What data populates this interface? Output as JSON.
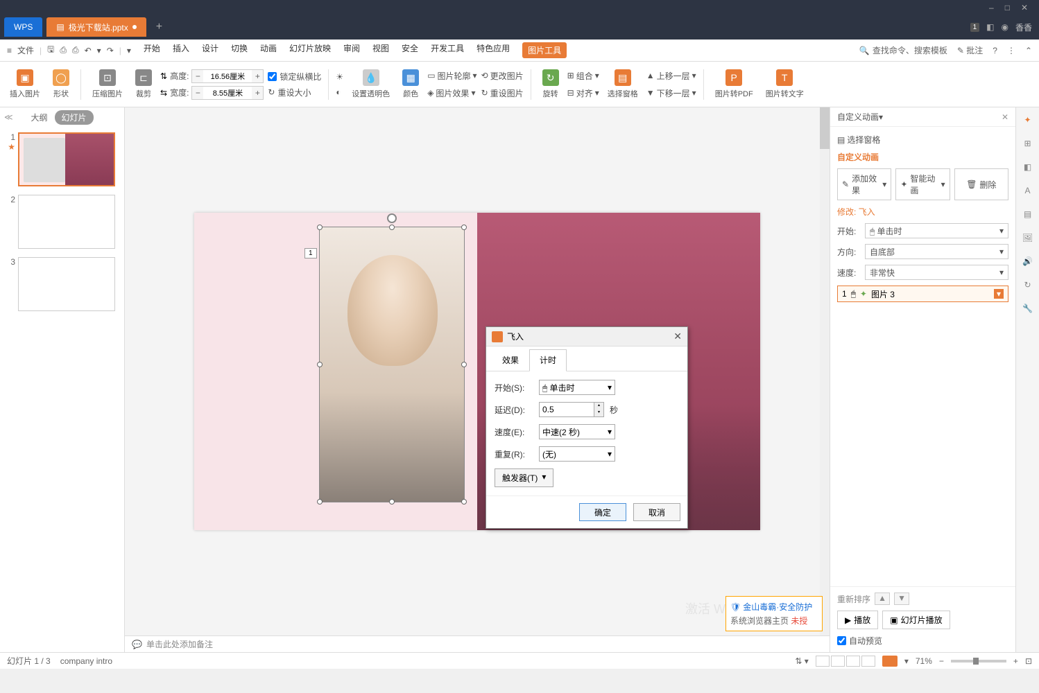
{
  "titlebar": {
    "minimize": "–",
    "maximize": "□",
    "close": "✕"
  },
  "tabbar": {
    "wps": "WPS",
    "filename": "极光下载站.pptx",
    "add": "+",
    "badge": "1",
    "user": "香香"
  },
  "menubar": {
    "file": "文件",
    "items": [
      "开始",
      "插入",
      "设计",
      "切换",
      "动画",
      "幻灯片放映",
      "审阅",
      "视图",
      "安全",
      "开发工具",
      "特色应用"
    ],
    "active": "图片工具",
    "search_placeholder": "查找命令、搜索模板",
    "annotate": "批注"
  },
  "toolbar": {
    "insert_pic": "插入图片",
    "shape": "形状",
    "compress": "压缩图片",
    "crop": "裁剪",
    "height_lbl": "高度:",
    "height": "16.56厘米",
    "width_lbl": "宽度:",
    "width": "8.55厘米",
    "lock": "锁定纵横比",
    "reset_size": "重设大小",
    "transparency": "设置透明色",
    "color": "颜色",
    "outline": "图片轮廓",
    "effect": "图片效果",
    "change": "更改图片",
    "reset_pic": "重设图片",
    "rotate": "旋转",
    "group": "组合",
    "align": "对齐",
    "sel_pane": "选择窗格",
    "up_layer": "上移一层",
    "down_layer": "下移一层",
    "pdf": "图片转PDF",
    "text": "图片转文字"
  },
  "thumb_tabs": {
    "outline": "大纲",
    "slides": "幻灯片"
  },
  "slides": [
    {
      "n": "1",
      "star": "★"
    },
    {
      "n": "2"
    },
    {
      "n": "3"
    }
  ],
  "canvas": {
    "idx": "1"
  },
  "dialog": {
    "title": "飞入",
    "close": "✕",
    "tab_effect": "效果",
    "tab_timing": "计时",
    "start_lbl": "开始(S):",
    "start_val": "单击时",
    "delay_lbl": "延迟(D):",
    "delay_val": "0.5",
    "delay_unit": "秒",
    "speed_lbl": "速度(E):",
    "speed_val": "中速(2 秒)",
    "repeat_lbl": "重复(R):",
    "repeat_val": "(无)",
    "trigger": "触发器(T)",
    "ok": "确定",
    "cancel": "取消"
  },
  "notes_placeholder": "单击此处添加备注",
  "anim_panel": {
    "title": "自定义动画",
    "sel_pane": "选择窗格",
    "section": "自定义动画",
    "add_effect": "添加效果",
    "smart": "智能动画",
    "delete": "删除",
    "modify": "修改: 飞入",
    "start_lbl": "开始:",
    "start_val": "单击时",
    "dir_lbl": "方向:",
    "dir_val": "自底部",
    "speed_lbl": "速度:",
    "speed_val": "非常快",
    "item_n": "1",
    "item_name": "图片 3",
    "reorder": "重新排序",
    "play": "播放",
    "slideshow": "幻灯片播放",
    "auto_preview": "自动预览"
  },
  "activate": "激活 W",
  "popup": {
    "title": "金山毒霸·安全防护",
    "line": "系统浏览器主页",
    "warn": "未授"
  },
  "status": {
    "slide": "幻灯片 1 / 3",
    "template": "company intro",
    "zoom": "71%"
  }
}
